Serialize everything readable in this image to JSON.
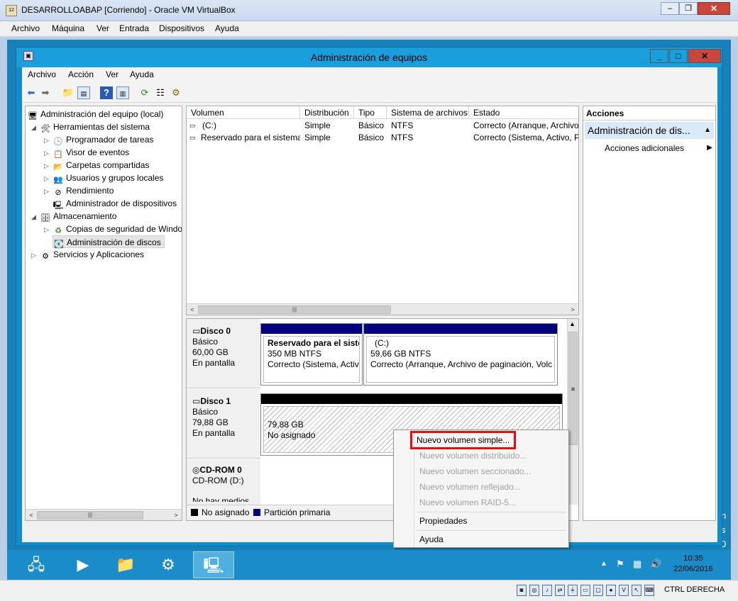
{
  "vbox": {
    "title": "DESARROLLOABAP [Corriendo] - Oracle VM VirtualBox",
    "menu": [
      "Archivo",
      "Máquina",
      "Ver",
      "Entrada",
      "Dispositivos",
      "Ayuda"
    ],
    "host_key": "CTRL DERECHA"
  },
  "app": {
    "title": "Administración de equipos",
    "menu": [
      "Archivo",
      "Acción",
      "Ver",
      "Ayuda"
    ]
  },
  "tree": {
    "items": [
      {
        "label": "Administración del equipo (local)",
        "icon": "computer-management-icon"
      },
      {
        "label": "Herramientas del sistema",
        "icon": "system-tools-icon"
      },
      {
        "label": "Programador de tareas",
        "icon": "task-scheduler-icon"
      },
      {
        "label": "Visor de eventos",
        "icon": "event-viewer-icon"
      },
      {
        "label": "Carpetas compartidas",
        "icon": "shared-folders-icon"
      },
      {
        "label": "Usuarios y grupos locales",
        "icon": "users-groups-icon"
      },
      {
        "label": "Rendimiento",
        "icon": "performance-icon"
      },
      {
        "label": "Administrador de dispositivos",
        "icon": "device-manager-icon"
      },
      {
        "label": "Almacenamiento",
        "icon": "storage-icon"
      },
      {
        "label": "Copias de seguridad de Windo",
        "icon": "backup-icon"
      },
      {
        "label": "Administración de discos",
        "icon": "disk-management-icon"
      },
      {
        "label": "Servicios y Aplicaciones",
        "icon": "services-apps-icon"
      }
    ]
  },
  "volumes": {
    "columns": [
      "Volumen",
      "Distribución",
      "Tipo",
      "Sistema de archivos",
      "Estado"
    ],
    "rows": [
      {
        "volume": "(C:)",
        "layout": "Simple",
        "type": "Básico",
        "fs": "NTFS",
        "status": "Correcto (Arranque, Archivo"
      },
      {
        "volume": "Reservado para el sistema",
        "layout": "Simple",
        "type": "Básico",
        "fs": "NTFS",
        "status": "Correcto (Sistema, Activo, Pa"
      }
    ]
  },
  "disks": {
    "disk0": {
      "name": "Disco 0",
      "kind": "Básico",
      "size": "60,00 GB",
      "state": "En pantalla",
      "p1": {
        "name": "Reservado para el sister",
        "size": "350 MB NTFS",
        "status": "Correcto (Sistema, Activo"
      },
      "p2": {
        "name": "(C:)",
        "size": "59,66 GB NTFS",
        "status": "Correcto (Arranque, Archivo de paginación, Volc"
      }
    },
    "disk1": {
      "name": "Disco 1",
      "kind": "Básico",
      "size": "79,88 GB",
      "state": "En pantalla",
      "p1": {
        "size": "79,88 GB",
        "status": "No asignado"
      }
    },
    "cdrom": {
      "name": "CD-ROM 0",
      "drive": "CD-ROM (D:)",
      "media": "No hay medios"
    }
  },
  "legend": {
    "unallocated": "No asignado",
    "primary": "Partición primaria"
  },
  "actions": {
    "header": "Acciones",
    "section": "Administración de dis...",
    "more": "Acciones adicionales"
  },
  "context_menu": {
    "items": [
      {
        "label": "Nuevo volumen simple...",
        "enabled": true
      },
      {
        "label": "Nuevo volumen distribuido...",
        "enabled": false
      },
      {
        "label": "Nuevo volumen seccionado...",
        "enabled": false
      },
      {
        "label": "Nuevo volumen reflejado...",
        "enabled": false
      },
      {
        "label": "Nuevo volumen RAID-5...",
        "enabled": false
      },
      {
        "label": "Propiedades",
        "enabled": true
      },
      {
        "label": "Ayuda",
        "enabled": true
      }
    ]
  },
  "taskbar": {
    "time": "10:35",
    "date": "22/06/2016"
  },
  "colors": {
    "primary_partition": "#00007f",
    "unallocated": "#000000",
    "highlight_box": "#e01010"
  }
}
